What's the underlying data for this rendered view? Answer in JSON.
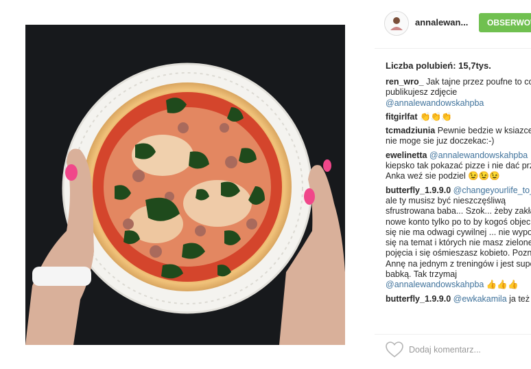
{
  "post": {
    "username": "annalewan...",
    "follow_label": "OBSERWOW",
    "likes": "Liczba polubień: 15,7tys.",
    "add_comment_placeholder": "Dodaj komentarz..."
  },
  "comments": [
    {
      "user": "ren_wro_",
      "mention": "",
      "text": " Jak tajne przez poufne to co publikujesz zdjęcie",
      "tail": "@annalewandowskahpba"
    },
    {
      "user": "fitgirlfat",
      "mention": "",
      "text": " 👏👏👏",
      "tail": ""
    },
    {
      "user": "tcmadziunia",
      "mention": "",
      "text": " Pewnie bedzie w ksiazce ktorej nie moge sie juz doczekac:-)",
      "tail": ""
    },
    {
      "user": "ewelinetta",
      "mention": " @annalewandowskahpba",
      "text": " kiepsko tak pokazać pizze i nie dać przepisu. Anka weź sie podziel 😉😉😉",
      "tail": ""
    },
    {
      "user": "butterfly_1.9.9.0",
      "mention": " @changeyourlife_to_now",
      "text": " ale ty musisz być nieszczęśliwą sfrustrowana baba... Szok... żeby zakładać nowe konto tylko po to by kogoś objechac bo się nie ma odwagi cywilnej ... nie wypowiadaj się na temat i których nie masz zielonego pojęcia i się ośmieszasz kobieto. Poznałam Annę na jednym z treningów i jest super babką. Tak trzymaj",
      "tail": "@annalewandowskahpba 👍👍👍"
    },
    {
      "user": "butterfly_1.9.9.0",
      "mention": " @ewkakamila",
      "text": " ja też",
      "tail": ""
    }
  ],
  "icons": {
    "heart": "heart-outline-icon",
    "avatar": "avatar-icon"
  },
  "colors": {
    "follow_button": "#70c050",
    "mention": "#3f729b",
    "photo_background": "#17191c"
  }
}
